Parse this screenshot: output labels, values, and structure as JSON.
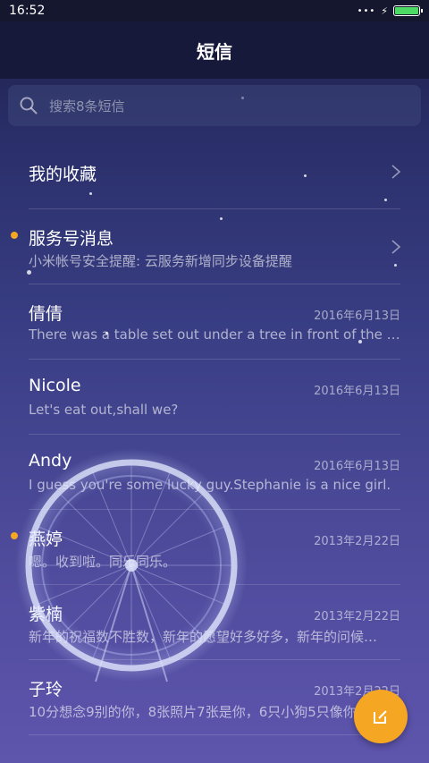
{
  "status_bar": {
    "time": "16:52",
    "signal": "•••",
    "charging": "⚡"
  },
  "header": {
    "title": "短信"
  },
  "search": {
    "placeholder": "搜索8条短信"
  },
  "favorites": {
    "label": "我的收藏"
  },
  "service": {
    "name": "服务号消息",
    "preview": "小米帐号安全提醒: 云服务新增同步设备提醒",
    "unread": true
  },
  "conversations": [
    {
      "name": "倩倩",
      "date": "2016年6月13日",
      "preview": "There was a table set out under a tree in front of the ho…",
      "unread": false
    },
    {
      "name": "Nicole",
      "date": "2016年6月13日",
      "preview": "Let's eat out,shall we?",
      "unread": false
    },
    {
      "name": "Andy",
      "date": "2016年6月13日",
      "preview": "I guess you're some lucky guy.Stephanie is a nice girl.",
      "unread": false
    },
    {
      "name": "燕婷",
      "date": "2013年2月22日",
      "preview": "嗯。收到啦。同乐同乐。",
      "unread": true
    },
    {
      "name": "紫楠",
      "date": "2013年2月22日",
      "preview": "新年的祝福数不胜数，新年的愿望好多好多，新年的问候…",
      "unread": false
    },
    {
      "name": "子玲",
      "date": "2013年2月22日",
      "preview": "10分想念9别的你，8张照片7张是你，6只小狗5只像你",
      "unread": false
    }
  ],
  "colors": {
    "accent": "#f5a623",
    "battery": "#4cd964",
    "header_bg": "#17193a"
  },
  "icons": {
    "search": "search-icon",
    "compose": "compose-icon",
    "chevron": "chevron-right-icon"
  }
}
